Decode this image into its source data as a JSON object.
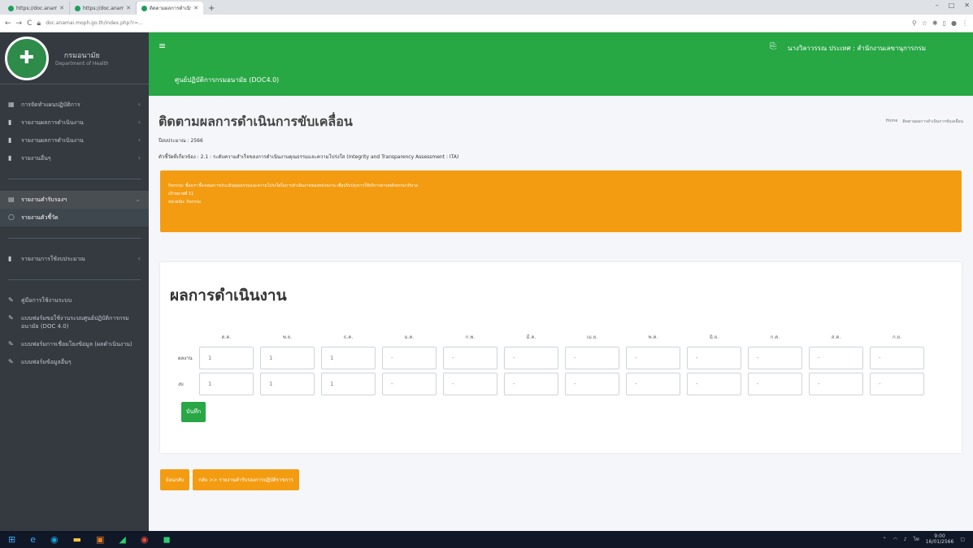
{
  "browser": {
    "tabs": [
      {
        "label": "https://doc.anamai.moph.go.th"
      },
      {
        "label": "https://doc.anamai.moph.go.th"
      },
      {
        "label": "ติดตามผลการดำเนินงาน"
      }
    ],
    "new_tab": "+",
    "window_controls": [
      "–",
      "□",
      "✕"
    ],
    "url": "doc.anamai.moph.go.th/index.php?r=...",
    "nav": [
      "←",
      "→",
      "C"
    ]
  },
  "sidebar": {
    "brand_title": "กรมอนามัย",
    "brand_subtitle": "Department of Health",
    "items": [
      {
        "label": "การจัดทำแผนปฏิบัติการ",
        "icon": "dashboard-icon"
      },
      {
        "label": "รายงานผลการดำเนินงาน",
        "icon": "book-icon"
      },
      {
        "label": "รายงานผลการดำเนินงาน",
        "icon": "book-icon"
      },
      {
        "label": "รายงานอื่นๆ",
        "icon": "book-icon"
      }
    ],
    "section_open": "รายงานคำรับรองฯ",
    "section_sub": "รายงานตัวชี้วัด",
    "item_integrity": "รายงานการใช้งบประมาณ",
    "lower_items": [
      "คู่มือการใช้งานระบบ",
      "แบบฟอร์มขอใช้งานระบบศูนย์ปฏิบัติการกรมอนามัย (DOC 4.0)",
      "แบบฟอร์มการเชื่อมโยงข้อมูล (ผลดำเนินงาน)",
      "แบบฟอร์มข้อมูลอื่นๆ"
    ]
  },
  "navbar": {
    "menu_icon": "≡",
    "site_title": "ศูนย์ปฏิบัติการกรมอนามัย (DOC4.0)",
    "user": "นางวิลาวรรณ ประเทศ : สำนักงานเลขานุการกรม"
  },
  "page": {
    "title": "ติดตามผลการดำเนินการขับเคลื่อน",
    "breadcrumb": [
      "Home",
      "ติดตามผลการดำเนินการขับเคลื่อน"
    ],
    "fiscal_year": "ปีงบประมาณ : 2566",
    "indicator": "ตัวชี้วัดที่เกี่ยวข้อง : 2.1 : ระดับความสำเร็จของการดำเนินงานคุณธรรมและความโปร่งใส (Integrity and Transparency Assessment : ITA)",
    "alert_lines": [
      "กิจกรรม: ชี้แจงฯ ชี้แจงผลการประเมินคุณธรรมและความโปร่งใสในการดำเนินงานของหน่วยงาน เพื่อปรับปรุงการให้บริการตามหลักธรรมาภิบาล",
      "เป้าหมายที่ 11",
      "หน่วยนับ: กิจกรรม"
    ]
  },
  "performance": {
    "title": "ผลการดำเนินงาน",
    "months": [
      "ต.ค.",
      "พ.ย.",
      "ธ.ค.",
      "ม.ค.",
      "ก.พ.",
      "มี.ค.",
      "เม.ย.",
      "พ.ค.",
      "มิ.ย.",
      "ก.ค.",
      "ส.ค.",
      "ก.ย."
    ],
    "rows": [
      {
        "label": "ผลงาน",
        "values": [
          "1",
          "1",
          "1",
          "-",
          "-",
          "-",
          "-",
          "-",
          "-",
          "-",
          "-",
          "-"
        ]
      },
      {
        "label": "งบ",
        "values": [
          "1",
          "1",
          "1",
          "-",
          "-",
          "-",
          "-",
          "-",
          "-",
          "-",
          "-",
          "-"
        ]
      }
    ],
    "save_label": "บันทึก"
  },
  "actions": {
    "back_label": "ย้อนกลับ",
    "report_label": "กลับ >> รายงานคำรับรองการปฏิบัติราชการ"
  },
  "taskbar": {
    "clock_time": "9:00",
    "clock_date": "16/01/2566"
  },
  "colors": {
    "primary_green": "#28a745",
    "sidebar_dark": "#343a40",
    "warning_orange": "#f39c12"
  }
}
